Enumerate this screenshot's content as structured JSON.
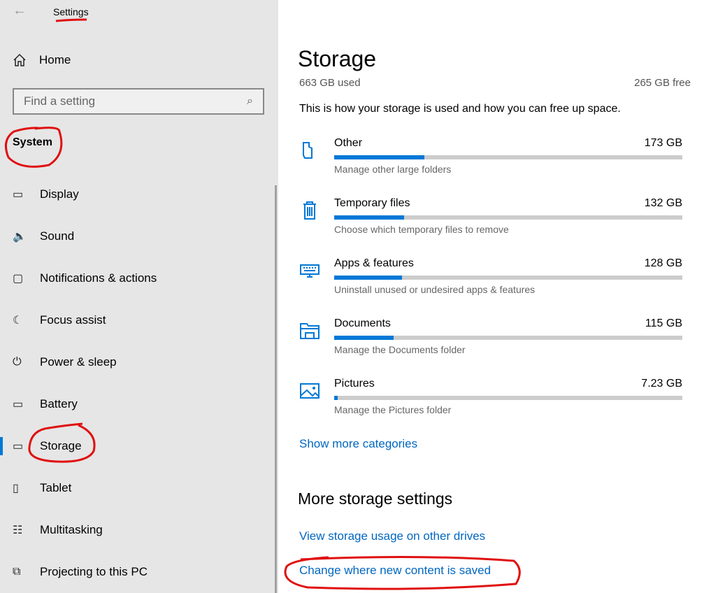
{
  "window": {
    "title": "Settings",
    "back_icon": "back-arrow-icon"
  },
  "sidebar": {
    "home": "Home",
    "search_placeholder": "Find a setting",
    "section": "System",
    "items": [
      {
        "label": "Display",
        "icon": "monitor-icon",
        "glyph": "▭"
      },
      {
        "label": "Sound",
        "icon": "speaker-icon",
        "glyph": "🔈"
      },
      {
        "label": "Notifications & actions",
        "icon": "message-icon",
        "glyph": "▢"
      },
      {
        "label": "Focus assist",
        "icon": "moon-icon",
        "glyph": "☾"
      },
      {
        "label": "Power & sleep",
        "icon": "power-icon",
        "glyph": "⏻"
      },
      {
        "label": "Battery",
        "icon": "battery-icon",
        "glyph": "▭"
      },
      {
        "label": "Storage",
        "icon": "drive-icon",
        "glyph": "▭",
        "selected": true
      },
      {
        "label": "Tablet",
        "icon": "tablet-icon",
        "glyph": "▯"
      },
      {
        "label": "Multitasking",
        "icon": "multitasking-icon",
        "glyph": "☷"
      },
      {
        "label": "Projecting to this PC",
        "icon": "projecting-icon",
        "glyph": "⧉"
      }
    ]
  },
  "main": {
    "title": "Storage",
    "used": "663 GB used",
    "free": "265 GB free",
    "intro": "This is how your storage is used and how you can free up space.",
    "categories": [
      {
        "name": "Other",
        "size": "173 GB",
        "desc": "Manage other large folders",
        "icon": "folder-other-icon",
        "percent": 26
      },
      {
        "name": "Temporary files",
        "size": "132 GB",
        "desc": "Choose which temporary files to remove",
        "icon": "trash-icon",
        "percent": 20
      },
      {
        "name": "Apps & features",
        "size": "128 GB",
        "desc": "Uninstall unused or undesired apps & features",
        "icon": "keyboard-icon",
        "percent": 19.5
      },
      {
        "name": "Documents",
        "size": "115 GB",
        "desc": "Manage the Documents folder",
        "icon": "documents-folder-icon",
        "percent": 17
      },
      {
        "name": "Pictures",
        "size": "7.23 GB",
        "desc": "Manage the Pictures folder",
        "icon": "picture-icon",
        "percent": 1
      }
    ],
    "show_more": "Show more categories",
    "more_title": "More storage settings",
    "links": [
      "View storage usage on other drives",
      "Change where new content is saved"
    ]
  },
  "colors": {
    "accent": "#0078d7",
    "link": "#0067c0",
    "annotation": "#e01010"
  }
}
